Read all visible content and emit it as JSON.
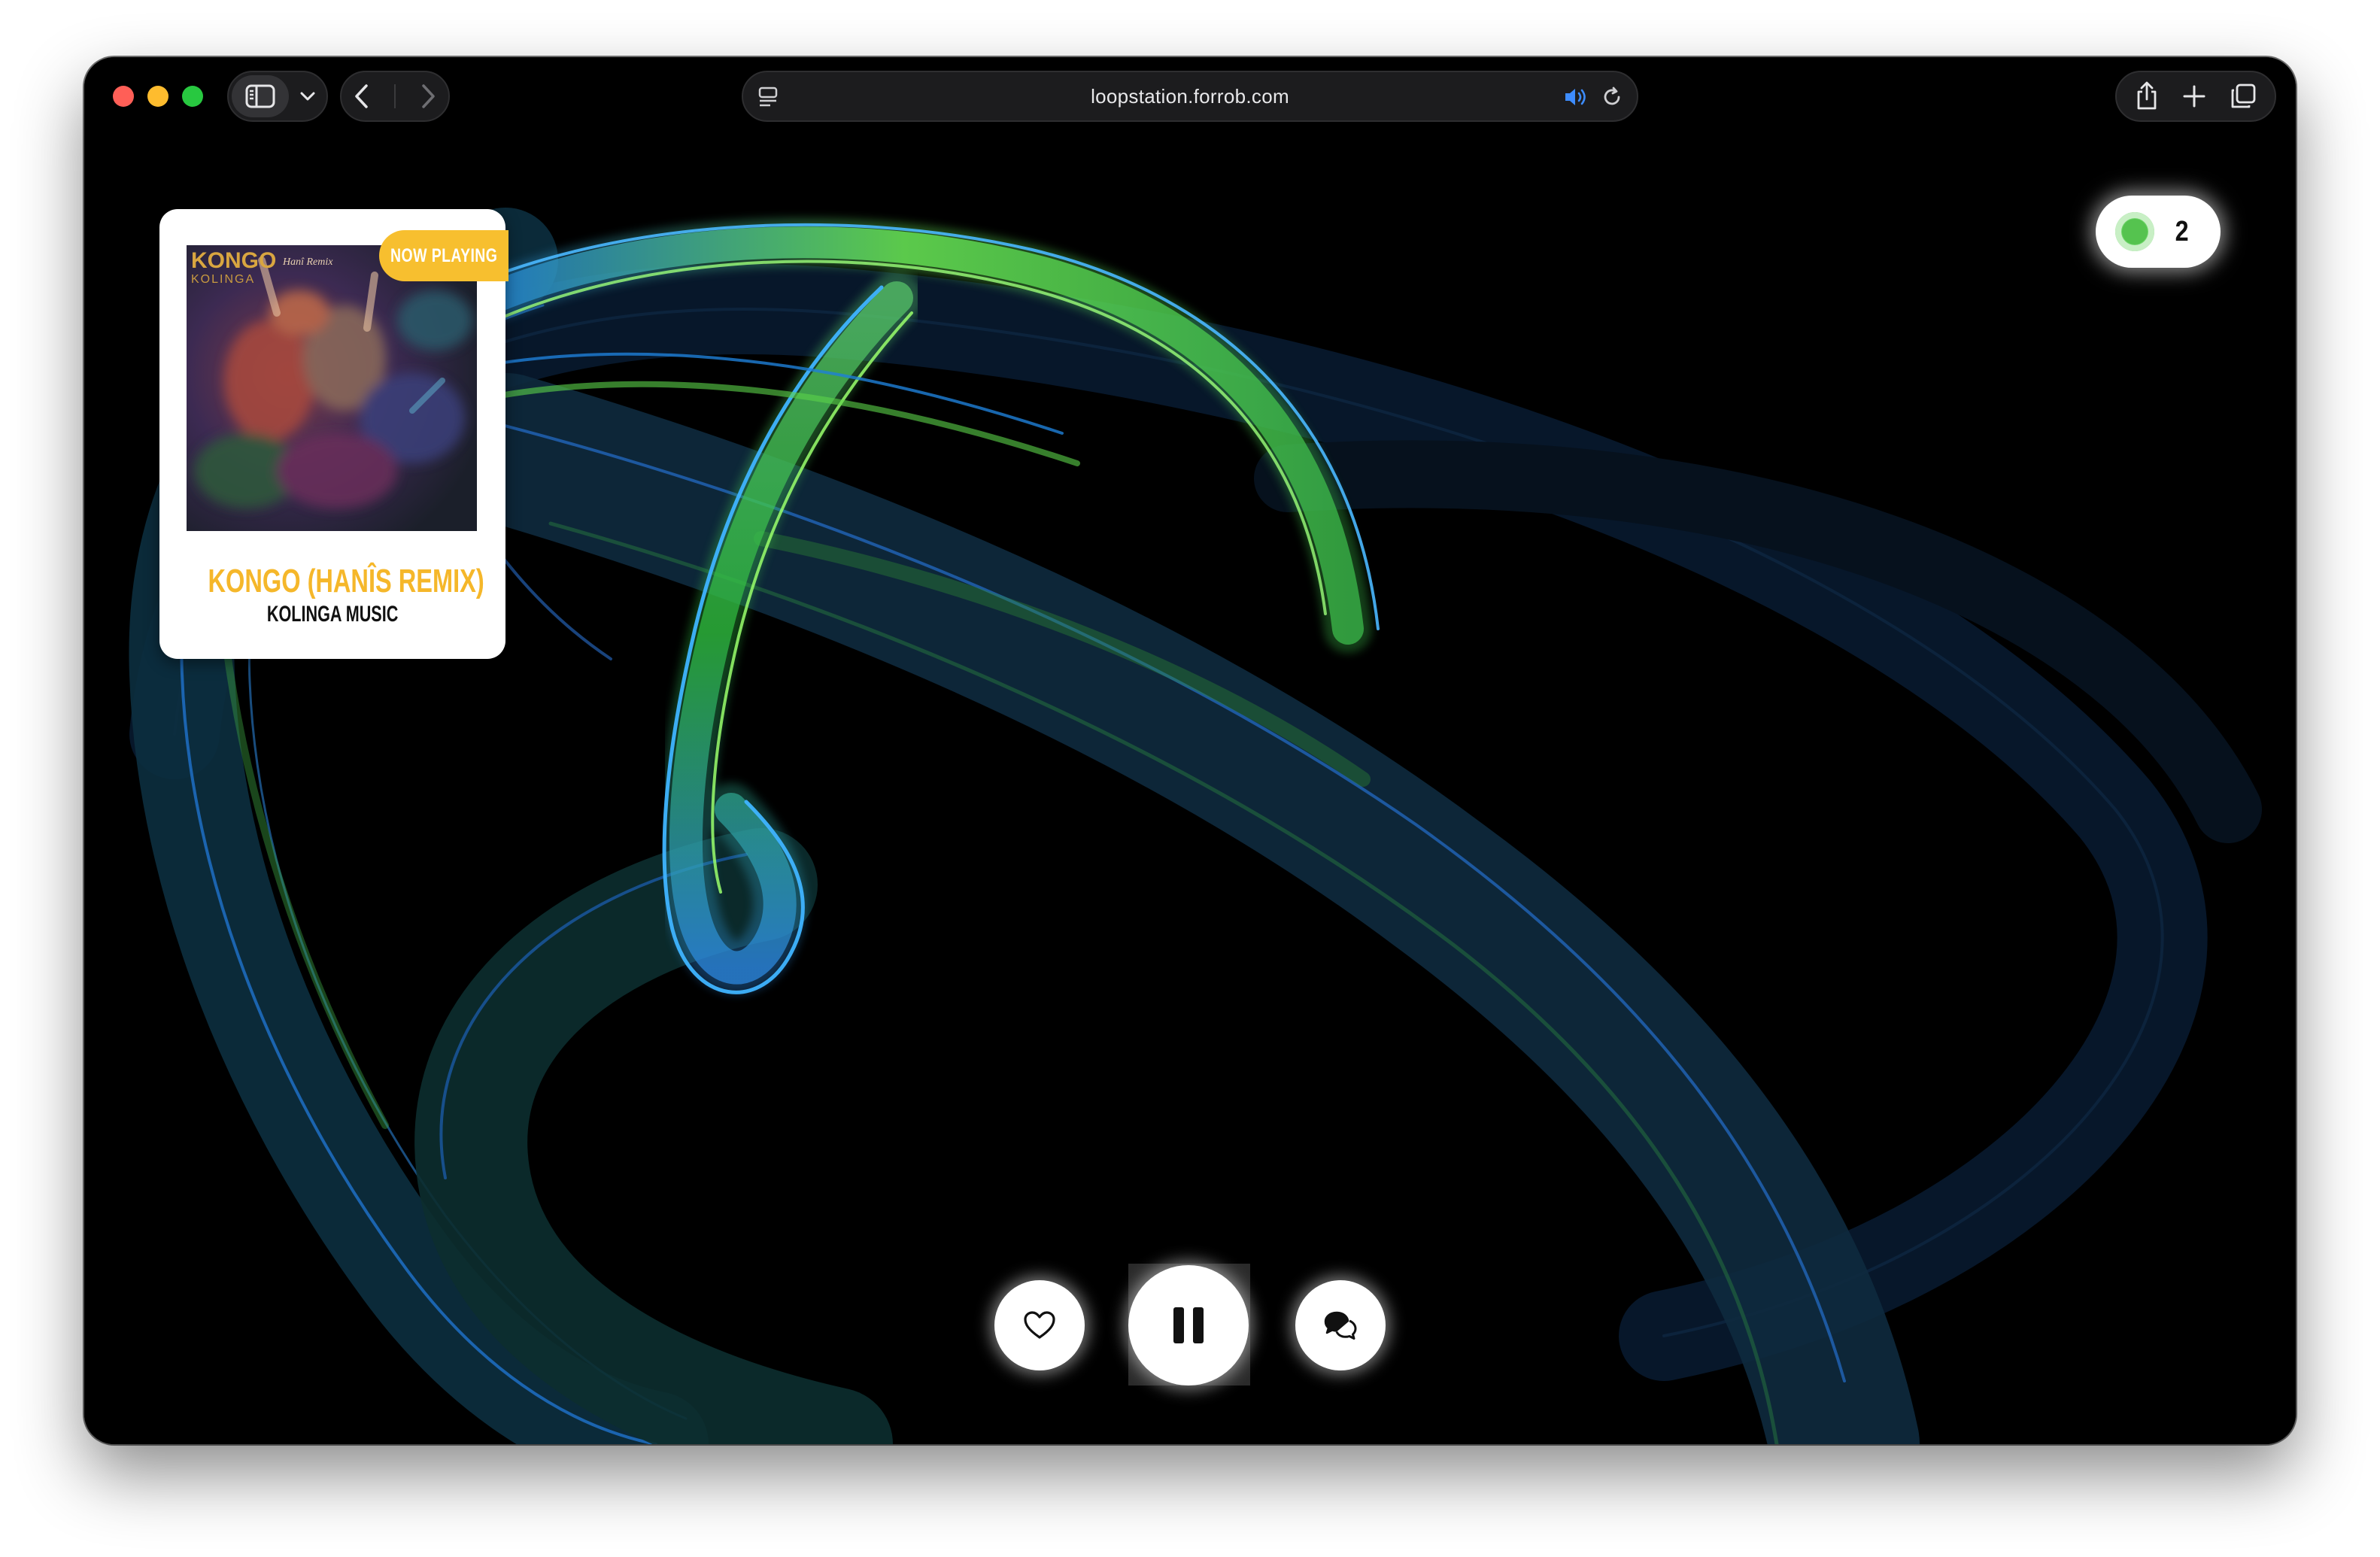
{
  "browser": {
    "url": "loopstation.forrob.com",
    "icons": {
      "sidebar": "sidebar-icon",
      "sidebar_menu": "chevron-down-icon",
      "back": "chevron-left-icon",
      "forward": "chevron-right-icon",
      "reader": "reader-icon",
      "audio": "speaker-icon",
      "reload": "reload-icon",
      "share": "share-icon",
      "new_tab": "plus-icon",
      "tabs": "tabs-overview-icon"
    },
    "colors": {
      "close": "#ff5f57",
      "minimize": "#febc2e",
      "zoom": "#28c840",
      "audio_accent": "#3d8cff"
    }
  },
  "listeners": {
    "count": "2",
    "status_color": "#55c34f"
  },
  "now_playing": {
    "badge": "NOW PLAYING",
    "title": "KONGO (HANÎS REMIX)",
    "artist": "KOLINGA MUSIC",
    "cover": {
      "artist_word": "KONGO",
      "subtitle": "Hanî Remix",
      "label": "KOLINGA"
    },
    "accent": "#f5b72a"
  },
  "controls": {
    "like_icon": "heart-icon",
    "play_state": "playing",
    "play_icon": "pause-icon",
    "chat_icon": "chat-icon"
  }
}
